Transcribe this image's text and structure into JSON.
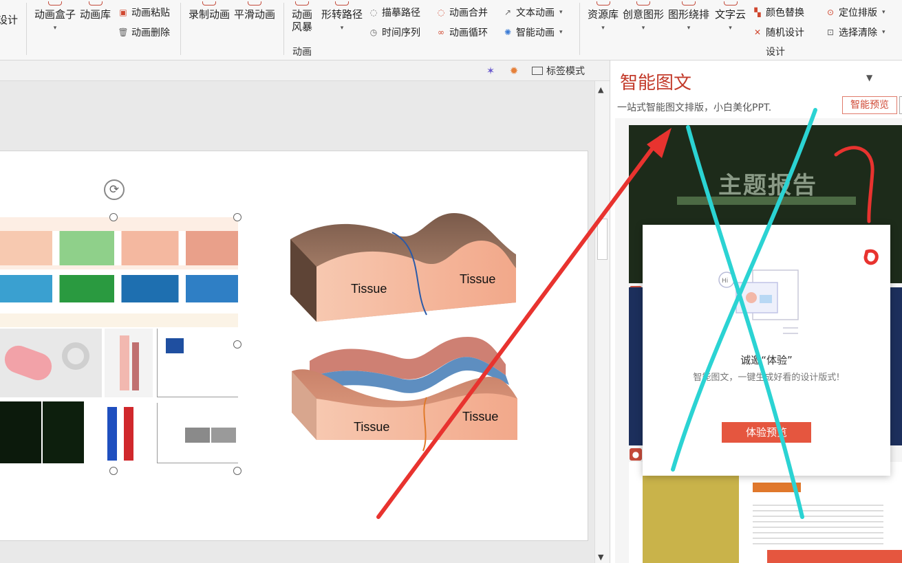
{
  "ribbon": {
    "cut_left": "设计",
    "anim_box": "动画盒子",
    "anim_lib": "动画库",
    "anim_paste": "动画粘贴",
    "anim_delete": "动画删除",
    "record_anim": "录制动画",
    "smooth_anim": "平滑动画",
    "anim_storm_1": "动画",
    "anim_storm_2": "风暴",
    "shape_path": "形转路径",
    "trace_path": "描摹路径",
    "time_seq": "时间序列",
    "anim_merge": "动画合并",
    "anim_loop": "动画循环",
    "text_anim": "文本动画",
    "smart_anim": "智能动画",
    "group_anim": "动画",
    "res_lib": "资源库",
    "creative_shape": "创意图形",
    "shape_wrap": "图形绕排",
    "word_cloud": "文字云",
    "color_replace": "颜色替换",
    "random_design": "随机设计",
    "position_layout": "定位排版",
    "select_clear": "选择清除",
    "group_design": "设计"
  },
  "toolbar": {
    "tab_mode": "标签模式"
  },
  "slide": {
    "tissue_1": "Tissue",
    "tissue_2": "Tissue",
    "tissue_3": "Tissue",
    "tissue_4": "Tissue"
  },
  "panel": {
    "title": "智能图文",
    "subtitle": "一站式智能图文排版，小白美化PPT.",
    "preview_btn": "智能预览",
    "theme_title": "主题报告"
  },
  "modal": {
    "title": "诚邀“体验”",
    "desc": "智能图文，一键生成好看的设计版式!",
    "button": "体验预览"
  },
  "colors": {
    "accent": "#e5563f",
    "title_red": "#c33a2a",
    "annot_cyan": "#2bd3d3",
    "annot_red": "#e8332f"
  }
}
